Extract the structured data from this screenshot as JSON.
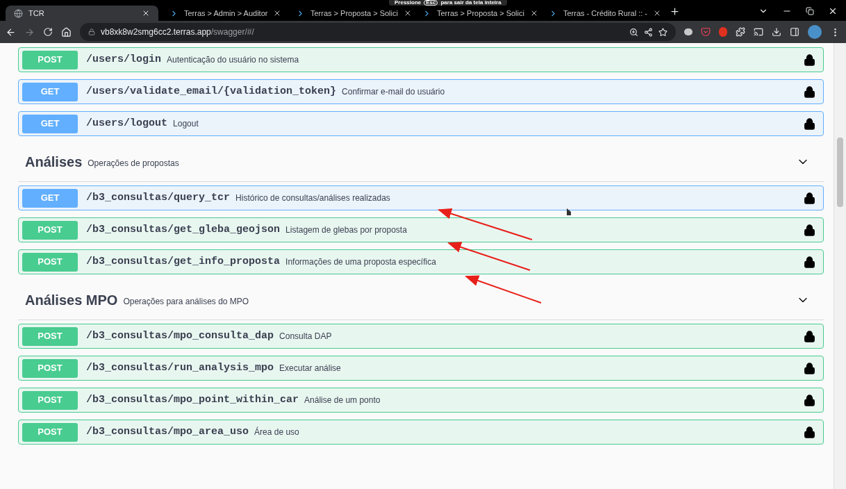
{
  "browser": {
    "tabs": [
      {
        "title": "TCR",
        "selected": true
      },
      {
        "title": "Terras > Admin > Auditor",
        "selected": false
      },
      {
        "title": "Terras > Proposta > Solici",
        "selected": false
      },
      {
        "title": "Terras > Proposta > Solici",
        "selected": false
      },
      {
        "title": "Terras - Crédito Rural :: -",
        "selected": false
      }
    ],
    "fullscreen_notice": {
      "before": "Pressione",
      "key": "Esc",
      "after": "para sair da tela inteira"
    },
    "address": {
      "host": "vb8xk8w2smg6cc2.terras.app",
      "path": "/swagger/#/"
    }
  },
  "sections": [
    {
      "operations": [
        {
          "method": "POST",
          "path": "/users/login",
          "description": "Autenticação do usuário no sistema",
          "locked": true
        },
        {
          "method": "GET",
          "path": "/users/validate_email/{validation_token}",
          "description": "Confirmar e-mail do usuário",
          "locked": true
        },
        {
          "method": "GET",
          "path": "/users/logout",
          "description": "Logout",
          "locked": true
        }
      ]
    },
    {
      "title": "Análises",
      "description": "Operações de propostas",
      "expanded": true,
      "operations": [
        {
          "method": "GET",
          "path": "/b3_consultas/query_tcr",
          "description": "Histórico de consultas/análises realizadas",
          "locked": true
        },
        {
          "method": "POST",
          "path": "/b3_consultas/get_gleba_geojson",
          "description": "Listagem de glebas por proposta",
          "locked": true
        },
        {
          "method": "POST",
          "path": "/b3_consultas/get_info_proposta",
          "description": "Informações de uma proposta específica",
          "locked": true
        }
      ]
    },
    {
      "title": "Análises MPO",
      "description": "Operações para análises do MPO",
      "expanded": true,
      "operations": [
        {
          "method": "POST",
          "path": "/b3_consultas/mpo_consulta_dap",
          "description": "Consulta DAP",
          "locked": true
        },
        {
          "method": "POST",
          "path": "/b3_consultas/run_analysis_mpo",
          "description": "Executar análise",
          "locked": true
        },
        {
          "method": "POST",
          "path": "/b3_consultas/mpo_point_within_car",
          "description": "Análise de um ponto",
          "locked": true
        },
        {
          "method": "POST",
          "path": "/b3_consultas/mpo_area_uso",
          "description": "Área de uso",
          "locked": true
        }
      ]
    }
  ]
}
